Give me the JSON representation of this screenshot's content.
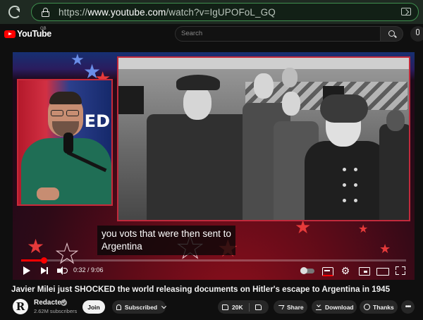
{
  "browser": {
    "url_prefix": "https://",
    "url_domain": "www.youtube.com",
    "url_path": "/watch?v=IgUPOFoL_GQ"
  },
  "header": {
    "logo_text": "YouTube",
    "country_code": "GB",
    "search_placeholder": "Search"
  },
  "player": {
    "studio_text": "ED",
    "caption_line1": "you vots that were then sent to",
    "caption_line2": "Argentina",
    "time_display": "0:32 / 9:06",
    "progress_fraction": 0.0586,
    "settings_glyph": "⚙"
  },
  "video": {
    "title": "Javier Milei just SHOCKED the world releasing documents on Hitler's escape to Argentina in 1945",
    "channel_logo_letter": "R",
    "channel_name": "Redacted",
    "subscribers": "2.62M subscribers",
    "join_label": "Join",
    "subscribed_label": "Subscribed",
    "like_count": "20K",
    "share_label": "Share",
    "download_label": "Download",
    "thanks_label": "Thanks",
    "more_label": "•••"
  }
}
